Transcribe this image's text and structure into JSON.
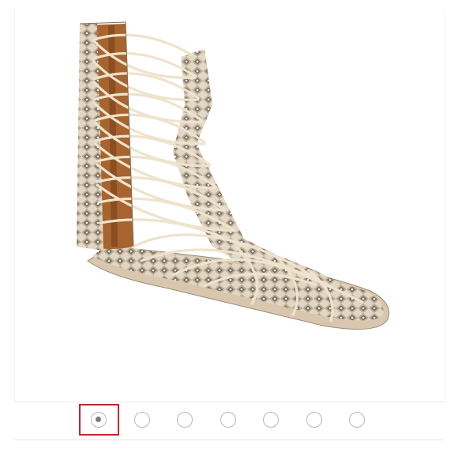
{
  "product_image": {
    "icon": "gladiator-sandal-photo",
    "colors": {
      "snakeskin_light": "#e4d8c6",
      "snakeskin_dark": "#6b6257",
      "lining": "#a8642e",
      "straps": "#ece0c8"
    }
  },
  "carousel": {
    "total": 7,
    "active_index": 0,
    "accent": "#c0272d"
  }
}
